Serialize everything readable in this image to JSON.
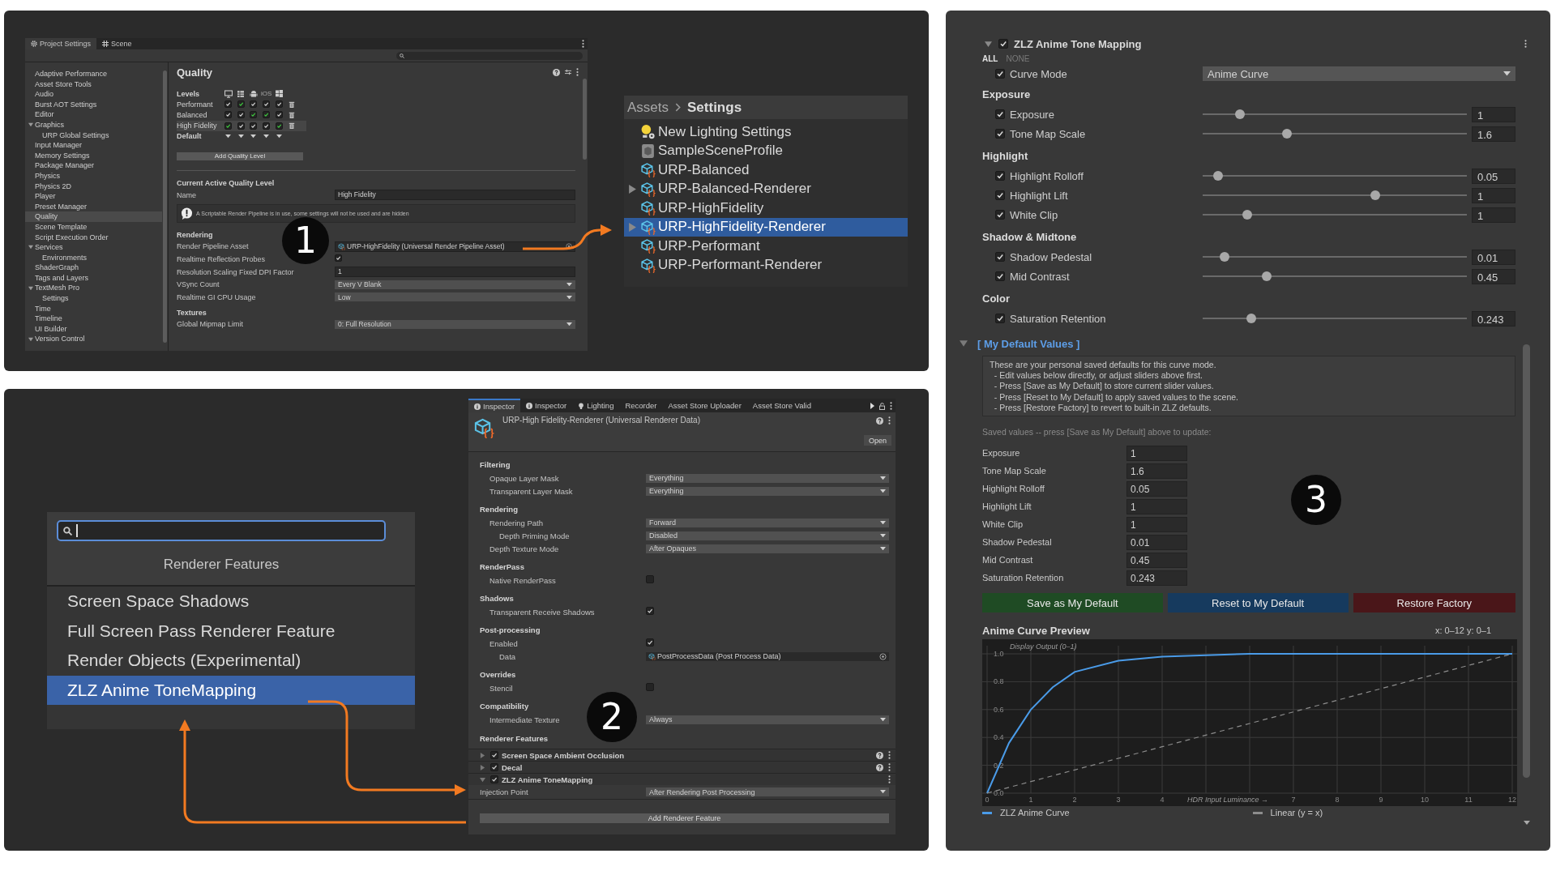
{
  "panel_1": {
    "project_settings": {
      "tabs": [
        {
          "label": "Project Settings",
          "kind": "settings",
          "selected": true
        },
        {
          "label": "Scene",
          "kind": "scene",
          "selected": false
        }
      ],
      "sidebar": {
        "items": [
          {
            "label": "Adaptive Performance",
            "selected": false
          },
          {
            "label": "Asset Store Tools",
            "selected": false
          },
          {
            "label": "Audio",
            "selected": false
          },
          {
            "label": "Burst AOT Settings",
            "selected": false
          },
          {
            "label": "Editor",
            "selected": false
          },
          {
            "label": "Graphics",
            "selected": false,
            "expanded": true,
            "children": [
              {
                "label": "URP Global Settings",
                "selected": false
              }
            ]
          },
          {
            "label": "Input Manager",
            "selected": false
          },
          {
            "label": "Memory Settings",
            "selected": false
          },
          {
            "label": "Package Manager",
            "selected": false
          },
          {
            "label": "Physics",
            "selected": false
          },
          {
            "label": "Physics 2D",
            "selected": false
          },
          {
            "label": "Player",
            "selected": false
          },
          {
            "label": "Preset Manager",
            "selected": false
          },
          {
            "label": "Quality",
            "selected": true
          },
          {
            "label": "Scene Template",
            "selected": false
          },
          {
            "label": "Script Execution Order",
            "selected": false
          },
          {
            "label": "Services",
            "selected": false,
            "expanded": true,
            "children": [
              {
                "label": "Environments",
                "selected": false
              }
            ]
          },
          {
            "label": "ShaderGraph",
            "selected": false
          },
          {
            "label": "Tags and Layers",
            "selected": false
          },
          {
            "label": "TextMesh Pro",
            "selected": false,
            "expanded": true,
            "children": [
              {
                "label": "Settings",
                "selected": false
              }
            ]
          },
          {
            "label": "Time",
            "selected": false
          },
          {
            "label": "Timeline",
            "selected": false
          },
          {
            "label": "UI Builder",
            "selected": false
          },
          {
            "label": "Version Control",
            "selected": false,
            "expanded": true
          }
        ]
      },
      "quality": {
        "title": "Quality",
        "levels_label": "Levels",
        "platforms": [
          {
            "kind": "desktop"
          },
          {
            "kind": "webgl"
          },
          {
            "kind": "android"
          },
          {
            "kind": "text",
            "label": "iOS"
          },
          {
            "kind": "windows"
          }
        ],
        "levels": [
          {
            "name": "Performant",
            "selected": false,
            "checks": [
              {
                "checked": true,
                "default": false
              },
              {
                "checked": true,
                "default": true
              },
              {
                "checked": true,
                "default": false
              },
              {
                "checked": true,
                "default": false
              },
              {
                "checked": true,
                "default": false
              }
            ]
          },
          {
            "name": "Balanced",
            "selected": false,
            "checks": [
              {
                "checked": true,
                "default": false
              },
              {
                "checked": true,
                "default": false
              },
              {
                "checked": true,
                "default": true
              },
              {
                "checked": true,
                "default": true
              },
              {
                "checked": true,
                "default": false
              }
            ]
          },
          {
            "name": "High Fidelity",
            "selected": true,
            "checks": [
              {
                "checked": true,
                "default": true
              },
              {
                "checked": true,
                "default": false
              },
              {
                "checked": true,
                "default": false
              },
              {
                "checked": true,
                "default": false
              },
              {
                "checked": true,
                "default": true
              }
            ]
          }
        ],
        "default_label": "Default",
        "add_button": "Add Quality Level",
        "current_heading": "Current Active Quality Level",
        "name_label": "Name",
        "name_value": "High Fidelity",
        "warning": "A Scriptable Render Pipeline is in use, some settings will not be used and are hidden",
        "sections": [
          {
            "heading": "Rendering",
            "rows": [
              {
                "kind": "object",
                "label": "Render Pipeline Asset",
                "value": "URP-HighFidelity (Universal Render Pipeline Asset)"
              },
              {
                "kind": "checkbox",
                "label": "Realtime Reflection Probes",
                "checked": true
              },
              {
                "kind": "text",
                "label": "Resolution Scaling Fixed DPI Factor",
                "value": "1"
              },
              {
                "kind": "dropdown",
                "label": "VSync Count",
                "value": "Every V Blank"
              },
              {
                "kind": "dropdown",
                "label": "Realtime GI CPU Usage",
                "value": "Low"
              }
            ]
          },
          {
            "heading": "Textures",
            "rows": [
              {
                "kind": "dropdown",
                "label": "Global Mipmap Limit",
                "value": "0: Full Resolution"
              }
            ]
          }
        ]
      }
    },
    "asset_browser": {
      "breadcrumb": [
        "Assets",
        "Settings"
      ],
      "items": [
        {
          "label": "New Lighting Settings",
          "kind": "lighting",
          "expandable": false,
          "selected": false
        },
        {
          "label": "SampleSceneProfile",
          "kind": "profile",
          "expandable": false,
          "selected": false
        },
        {
          "label": "URP-Balanced",
          "kind": "asset",
          "expandable": false,
          "selected": false
        },
        {
          "label": "URP-Balanced-Renderer",
          "kind": "asset",
          "expandable": true,
          "selected": false
        },
        {
          "label": "URP-HighFidelity",
          "kind": "asset",
          "expandable": false,
          "selected": false
        },
        {
          "label": "URP-HighFidelity-Renderer",
          "kind": "asset",
          "expandable": true,
          "selected": true
        },
        {
          "label": "URP-Performant",
          "kind": "asset",
          "expandable": false,
          "selected": false
        },
        {
          "label": "URP-Performant-Renderer",
          "kind": "asset",
          "expandable": false,
          "selected": false
        }
      ]
    },
    "step_badge": "1"
  },
  "panel_2": {
    "feature_picker": {
      "heading": "Renderer Features",
      "items": [
        {
          "label": "Screen Space Shadows",
          "selected": false
        },
        {
          "label": "Full Screen Pass Renderer Feature",
          "selected": false
        },
        {
          "label": "Render Objects (Experimental)",
          "selected": false
        },
        {
          "label": "ZLZ Anime ToneMapping",
          "selected": true
        }
      ]
    },
    "inspector": {
      "tabs": [
        {
          "label": "Inspector",
          "kind": "info",
          "selected": true
        },
        {
          "label": "Inspector",
          "kind": "info",
          "selected": false
        },
        {
          "label": "Lighting",
          "kind": "light",
          "selected": false
        },
        {
          "label": "Recorder",
          "kind": "plain",
          "selected": false
        },
        {
          "label": "Asset Store Uploader",
          "kind": "plain",
          "selected": false
        },
        {
          "label": "Asset Store Valid",
          "kind": "plain",
          "selected": false
        }
      ],
      "title": "URP-High Fidelity-Renderer (Universal Renderer Data)",
      "open_button": "Open",
      "sections": [
        {
          "heading": "Filtering",
          "rows": [
            {
              "kind": "dropdown",
              "label": "Opaque Layer Mask",
              "value": "Everything"
            },
            {
              "kind": "dropdown",
              "label": "Transparent Layer Mask",
              "value": "Everything"
            }
          ]
        },
        {
          "heading": "Rendering",
          "rows": [
            {
              "kind": "dropdown",
              "label": "Rendering Path",
              "value": "Forward",
              "children": [
                {
                  "kind": "dropdown",
                  "label": "Depth Priming Mode",
                  "value": "Disabled"
                }
              ]
            },
            {
              "kind": "dropdown",
              "label": "Depth Texture Mode",
              "value": "After Opaques"
            }
          ]
        },
        {
          "heading": "RenderPass",
          "rows": [
            {
              "kind": "checkbox",
              "label": "Native RenderPass",
              "checked": false
            }
          ]
        },
        {
          "heading": "Shadows",
          "rows": [
            {
              "kind": "checkbox",
              "label": "Transparent Receive Shadows",
              "checked": true
            }
          ]
        },
        {
          "heading": "Post-processing",
          "rows": [
            {
              "kind": "checkbox",
              "label": "Enabled",
              "checked": true,
              "children": [
                {
                  "kind": "object",
                  "label": "Data",
                  "value": "PostProcessData (Post Process Data)"
                }
              ]
            }
          ]
        },
        {
          "heading": "Overrides",
          "rows": [
            {
              "kind": "checkbox",
              "label": "Stencil",
              "checked": false
            }
          ]
        },
        {
          "heading": "Compatibility",
          "rows": [
            {
              "kind": "dropdown",
              "label": "Intermediate Texture",
              "value": "Always"
            }
          ]
        }
      ],
      "features_heading": "Renderer Features",
      "features": [
        {
          "label": "Screen Space Ambient Occlusion",
          "enabled": true,
          "expanded": false,
          "help": true
        },
        {
          "label": "Decal",
          "enabled": true,
          "expanded": false,
          "help": true
        },
        {
          "label": "ZLZ Anime ToneMapping",
          "enabled": true,
          "expanded": true,
          "help": false,
          "rows": [
            {
              "kind": "dropdown",
              "label": "Injection Point",
              "value": "After Rendering Post Processing"
            }
          ]
        }
      ],
      "add_button": "Add Renderer Feature"
    },
    "step_badge": "2"
  },
  "panel_3": {
    "component": {
      "title": "ZLZ Anime Tone Mapping",
      "enabled": true,
      "expanded": true
    },
    "toggle_links": [
      {
        "label": "ALL",
        "disabled": false
      },
      {
        "label": "NONE",
        "disabled": true
      }
    ],
    "curve_mode": {
      "label": "Curve Mode",
      "checked": true,
      "value": "Anime Curve"
    },
    "groups": [
      {
        "heading": "Exposure",
        "params": [
          {
            "label": "Exposure",
            "checked": true,
            "level": 0.126,
            "value": "1"
          },
          {
            "label": "Tone Map Scale",
            "checked": true,
            "level": 0.313,
            "value": "1.6"
          }
        ]
      },
      {
        "heading": "Highlight",
        "params": [
          {
            "label": "Highlight Rolloff",
            "checked": true,
            "level": 0.04,
            "value": "0.05"
          },
          {
            "label": "Highlight Lift",
            "checked": true,
            "level": 0.658,
            "value": "1"
          },
          {
            "label": "White Clip",
            "checked": true,
            "level": 0.156,
            "value": "1"
          }
        ]
      },
      {
        "heading": "Shadow & Midtone",
        "params": [
          {
            "label": "Shadow Pedestal",
            "checked": true,
            "level": 0.066,
            "value": "0.01"
          },
          {
            "label": "Mid Contrast",
            "checked": true,
            "level": 0.232,
            "value": "0.45"
          }
        ]
      },
      {
        "heading": "Color",
        "params": [
          {
            "label": "Saturation Retention",
            "checked": true,
            "level": 0.173,
            "value": "0.243"
          }
        ]
      }
    ],
    "defaults": {
      "title": "[ My Default Values ]",
      "expanded": true,
      "help": "These are your personal saved defaults for this curve mode.\n  - Edit values below directly, or adjust sliders above first.\n  - Press [Save as My Default] to store current slider values.\n  - Press [Reset to My Default] to apply saved values to the scene.\n  - Press [Restore Factory] to revert to built-in ZLZ defaults.",
      "caption": "Saved values -- press [Save as My Default] above to update:",
      "saved": [
        {
          "label": "Exposure",
          "value": "1"
        },
        {
          "label": "Tone Map Scale",
          "value": "1.6"
        },
        {
          "label": "Highlight Rolloff",
          "value": "0.05"
        },
        {
          "label": "Highlight Lift",
          "value": "1"
        },
        {
          "label": "White Clip",
          "value": "1"
        },
        {
          "label": "Shadow Pedestal",
          "value": "0.01"
        },
        {
          "label": "Mid Contrast",
          "value": "0.45"
        },
        {
          "label": "Saturation Retention",
          "value": "0.243"
        }
      ],
      "buttons": [
        {
          "label": "Save as My Default",
          "color": "#1f4b24"
        },
        {
          "label": "Reset to My Default",
          "color": "#163a5e"
        },
        {
          "label": "Restore Factory",
          "color": "#4a1619"
        }
      ]
    },
    "preview": {
      "title": "Anime Curve Preview",
      "range": "x: 0–12  y: 0–1",
      "chart_data": {
        "type": "line",
        "xlabel": "HDR Input Luminance →",
        "ylabel": "Display Output (0–1)",
        "x": [
          0,
          0.5,
          1,
          1.5,
          2,
          3,
          4,
          5,
          6,
          7,
          8,
          9,
          10,
          11,
          12
        ],
        "series": [
          {
            "name": "ZLZ Anime Curve",
            "color": "#4a9be8",
            "line_style": "solid",
            "values": [
              0,
              0.36,
              0.6,
              0.76,
              0.87,
              0.95,
              0.98,
              0.99,
              1,
              1,
              1,
              1,
              1,
              1,
              1
            ]
          },
          {
            "name": "Linear (y = x)",
            "color": "#8c8c8c",
            "line_style": "dashed",
            "values": [
              0,
              0.042,
              0.083,
              0.125,
              0.167,
              0.25,
              0.333,
              0.417,
              0.5,
              0.583,
              0.667,
              0.75,
              0.833,
              0.917,
              1
            ]
          }
        ],
        "xlim": [
          0,
          12
        ],
        "ylim": [
          0,
          1
        ],
        "grid": true,
        "xticks": [
          0,
          1,
          2,
          3,
          4,
          7,
          8,
          9,
          10,
          11,
          12
        ],
        "yticks": [
          {
            "value": 0,
            "label": "0.0"
          },
          {
            "value": 0.2,
            "label": "0.2"
          },
          {
            "value": 0.4,
            "label": "0.4"
          },
          {
            "value": 0.6,
            "label": "0.6"
          },
          {
            "value": 0.8,
            "label": "0.8"
          },
          {
            "value": 1,
            "label": "1.0"
          }
        ]
      }
    },
    "step_badge": "3"
  }
}
